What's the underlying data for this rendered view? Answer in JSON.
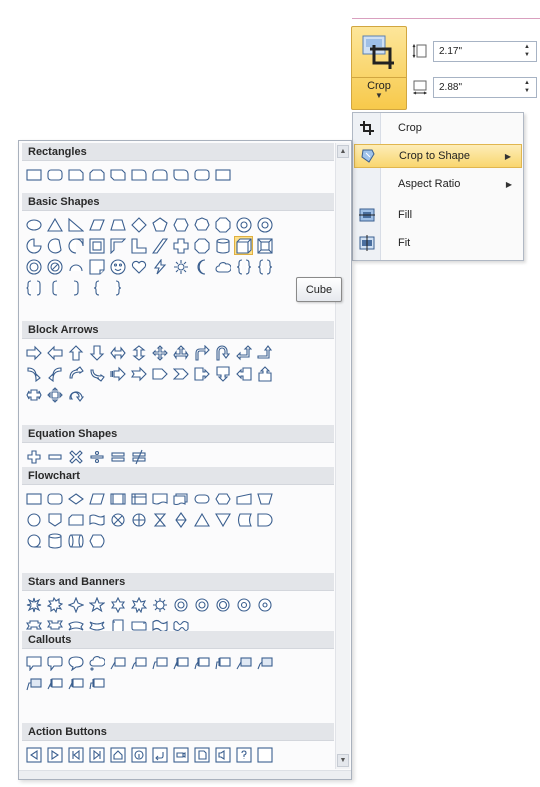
{
  "ribbon": {
    "crop_label": "Crop",
    "height_value": "2.17\"",
    "width_value": "2.88\""
  },
  "crop_menu": {
    "items": [
      {
        "label": "Crop",
        "icon": "crop-icon",
        "submenu": false
      },
      {
        "label": "Crop to Shape",
        "icon": "crop-to-shape-icon",
        "submenu": true,
        "highlighted": true
      },
      {
        "label": "Aspect Ratio",
        "icon": "",
        "submenu": true
      },
      {
        "label": "Fill",
        "icon": "fill-icon",
        "submenu": false
      },
      {
        "label": "Fit",
        "icon": "fit-icon",
        "submenu": false
      }
    ]
  },
  "tooltip": "Cube",
  "gallery": {
    "sections": [
      {
        "title": "Rectangles",
        "rows": [
          [
            "rect",
            "roundrect",
            "snip1",
            "snip2",
            "snip3",
            "round1",
            "round2",
            "round3",
            "roundrect",
            "rect"
          ]
        ]
      },
      {
        "title": "Basic Shapes",
        "rows": [
          [
            "ellipse",
            "triangle",
            "rtriangle",
            "parallelogram",
            "trapezoid",
            "diamond",
            "pentagon",
            "hexagon",
            "heptagon",
            "octagon",
            "circle",
            "circle"
          ],
          [
            "pie",
            "chord",
            "teardrop",
            "frame",
            "halfframe",
            "lshape",
            "slash",
            "cross",
            "octagon",
            "can",
            "cube",
            "bevel"
          ],
          [
            "donut",
            "noentry",
            "arc",
            "fold",
            "smiley",
            "heart",
            "bolt",
            "sun",
            "moon",
            "cloud",
            "brace",
            "brace"
          ],
          [
            "brackets",
            "lbracket",
            "rbracket",
            "lbrace",
            "rbrace"
          ]
        ]
      },
      {
        "title": "Block Arrows",
        "rows": [
          [
            "arrow-r",
            "arrow-l",
            "arrow-u",
            "arrow-d",
            "arrow-lr",
            "arrow-ud",
            "quad",
            "lrudarrow",
            "bent",
            "uturn",
            "lup",
            "bentup"
          ],
          [
            "curve-r",
            "curve-l",
            "curve-u",
            "curve-d",
            "striped",
            "notched",
            "pentagonarrow",
            "chevron",
            "callout-r",
            "callout-d",
            "callout-l",
            "callout-u"
          ],
          [
            "callout-lr",
            "callout-quad",
            "circular"
          ]
        ]
      },
      {
        "title": "Equation Shapes",
        "rows": [
          [
            "plus",
            "minus",
            "multiply",
            "divide",
            "equal",
            "notequal"
          ]
        ]
      },
      {
        "title": "Flowchart",
        "rows": [
          [
            "process",
            "altprocess",
            "decision",
            "data",
            "predefined",
            "internal",
            "document",
            "multidoc",
            "terminator",
            "prep",
            "manualinput",
            "manualop"
          ],
          [
            "connector",
            "offpage",
            "card",
            "punchtape",
            "sumjunction",
            "or",
            "collate",
            "sort",
            "extract",
            "merge",
            "stored",
            "delay"
          ],
          [
            "seqaccess",
            "magdisk",
            "directaccess",
            "display"
          ]
        ]
      },
      {
        "title": "Stars and Banners",
        "rows": [
          [
            "explosion1",
            "explosion2",
            "star4",
            "star5",
            "star6",
            "star7",
            "star8",
            "star10",
            "star12",
            "star16",
            "star24",
            "star32"
          ],
          [
            "ribbon-u",
            "ribbon-d",
            "curvedribbon-u",
            "curvedribbon-d",
            "scroll-v",
            "scroll-h",
            "wave",
            "doublewave"
          ]
        ]
      },
      {
        "title": "Callouts",
        "rows": [
          [
            "rectcallout",
            "roundcallout",
            "ovalcallout",
            "cloudcallout",
            "line1",
            "line2",
            "line3",
            "line1b",
            "line2b",
            "line3b",
            "line1c",
            "line2c"
          ],
          [
            "line3c",
            "line1d",
            "line2d",
            "line3d"
          ]
        ]
      },
      {
        "title": "Action Buttons",
        "rows": [
          [
            "back",
            "forward",
            "begin",
            "end",
            "home",
            "info",
            "return",
            "movie",
            "doc",
            "sound",
            "help",
            "blank"
          ]
        ]
      }
    ]
  },
  "colors": {
    "highlight": "#f9d66f",
    "shape_stroke": "#3b5f8f",
    "shape_fill": "#ffffff"
  }
}
